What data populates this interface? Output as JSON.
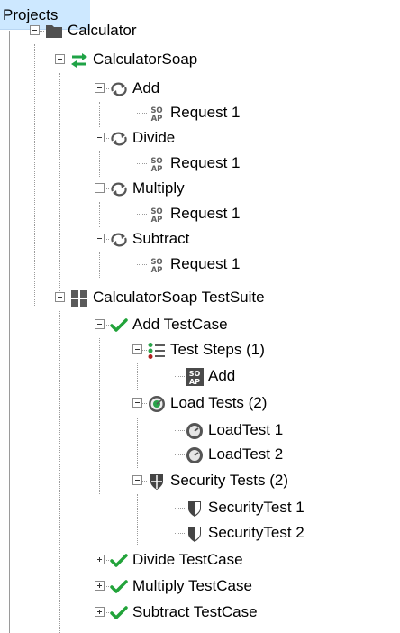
{
  "header": {
    "title": "Projects"
  },
  "tree": {
    "n0": {
      "label": "Calculator",
      "icon": "folder-icon"
    },
    "n1": {
      "label": "CalculatorSoap",
      "icon": "soap-interface-icon"
    },
    "n2": {
      "label": "Add",
      "icon": "operation-icon"
    },
    "n3": {
      "label": "Request 1",
      "icon": "soap-request-icon"
    },
    "n4": {
      "label": "Divide",
      "icon": "operation-icon"
    },
    "n5": {
      "label": "Request 1",
      "icon": "soap-request-icon"
    },
    "n6": {
      "label": "Multiply",
      "icon": "operation-icon"
    },
    "n7": {
      "label": "Request 1",
      "icon": "soap-request-icon"
    },
    "n8": {
      "label": "Subtract",
      "icon": "operation-icon"
    },
    "n9": {
      "label": "Request 1",
      "icon": "soap-request-icon"
    },
    "n10": {
      "label": "CalculatorSoap TestSuite",
      "icon": "test-suite-icon"
    },
    "n11": {
      "label": "Add TestCase",
      "icon": "checkmark-icon"
    },
    "n12": {
      "label": "Test Steps (1)",
      "icon": "test-steps-icon"
    },
    "n13": {
      "label": "Add",
      "icon": "soap-step-icon"
    },
    "n14": {
      "label": "Load Tests (2)",
      "icon": "load-tests-icon"
    },
    "n15": {
      "label": "LoadTest 1",
      "icon": "load-test-icon"
    },
    "n16": {
      "label": "LoadTest 2",
      "icon": "load-test-icon"
    },
    "n17": {
      "label": "Security Tests (2)",
      "icon": "security-tests-icon"
    },
    "n18": {
      "label": "SecurityTest 1",
      "icon": "security-test-icon"
    },
    "n19": {
      "label": "SecurityTest 2",
      "icon": "security-test-icon"
    },
    "n20": {
      "label": "Divide TestCase",
      "icon": "checkmark-icon"
    },
    "n21": {
      "label": "Multiply TestCase",
      "icon": "checkmark-icon"
    },
    "n22": {
      "label": "Subtract TestCase",
      "icon": "checkmark-icon"
    }
  },
  "colors": {
    "selection": "#cde8ff",
    "check_green": "#22a33a",
    "swap_green": "#1fa346"
  }
}
